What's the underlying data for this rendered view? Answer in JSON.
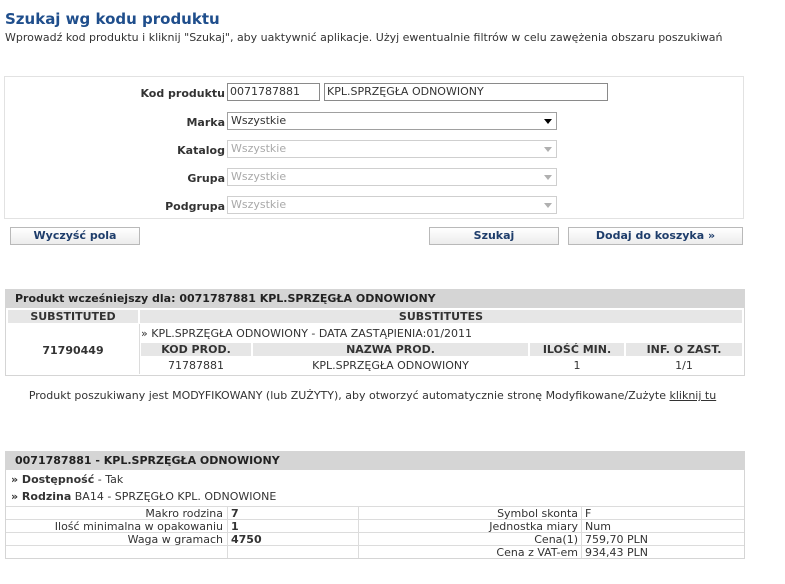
{
  "page": {
    "title": "Szukaj wg kodu produktu",
    "subtitle": "Wprowadź kod produktu i kliknij \"Szukaj\", aby uaktywnić aplikacje. Użyj ewentualnie filtrów w celu zawężenia obszaru poszukiwań"
  },
  "form": {
    "kod_label": "Kod produktu",
    "kod_value": "0071787881",
    "nazwa_value": "KPL.SPRZĘGŁA ODNOWIONY",
    "marka_label": "Marka",
    "marka_value": "Wszystkie",
    "katalog_label": "Katalog",
    "katalog_value": "Wszystkie",
    "grupa_label": "Grupa",
    "grupa_value": "Wszystkie",
    "podgrupa_label": "Podgrupa",
    "podgrupa_value": "Wszystkie"
  },
  "buttons": {
    "clear": "Wyczyść pola",
    "search": "Szukaj",
    "add_to_cart": "Dodaj do koszyka  »"
  },
  "substitutes": {
    "header": "Produkt wcześniejszy dla: 0071787881 KPL.SPRZĘGŁA ODNOWIONY",
    "col_substituted": "SUBSTITUTED",
    "col_substitutes": "SUBSTITUTES",
    "substituted_code": "71790449",
    "info_line": "» KPL.SPRZĘGŁA ODNOWIONY - DATA ZASTĄPIENIA:01/2011",
    "sub_headers": [
      "KOD PROD.",
      "NAZWA PROD.",
      "ILOŚĆ MIN.",
      "INF. O ZAST."
    ],
    "row": [
      "71787881",
      "KPL.SPRZĘGŁA ODNOWIONY",
      "1",
      "1/1"
    ]
  },
  "note": {
    "text": "Produkt poszukiwany jest MODYFIKOWANY (lub ZUŻYTY), aby otworzyć automatycznie stronę Modyfikowane/Zużyte ",
    "link": "kliknij tu"
  },
  "details": {
    "header": "0071787881 - KPL.SPRZĘGŁA ODNOWIONY",
    "availability_label": "» Dostępność",
    "availability_value": " - Tak",
    "family_label": "» Rodzina",
    "family_value": " BA14 - SPRZĘGŁO KPL. ODNOWIONE",
    "left_labels": [
      "Makro rodzina",
      "Ilość minimalna w opakowaniu",
      "Waga w gramach"
    ],
    "left_values": [
      "7",
      "1",
      "4750"
    ],
    "right_labels": [
      "Symbol skonta",
      "Jednostka miary",
      "Cena(1)",
      "Cena z VAT-em"
    ],
    "right_values": [
      "F",
      "Num",
      "759,70 PLN",
      "934,43 PLN"
    ]
  }
}
